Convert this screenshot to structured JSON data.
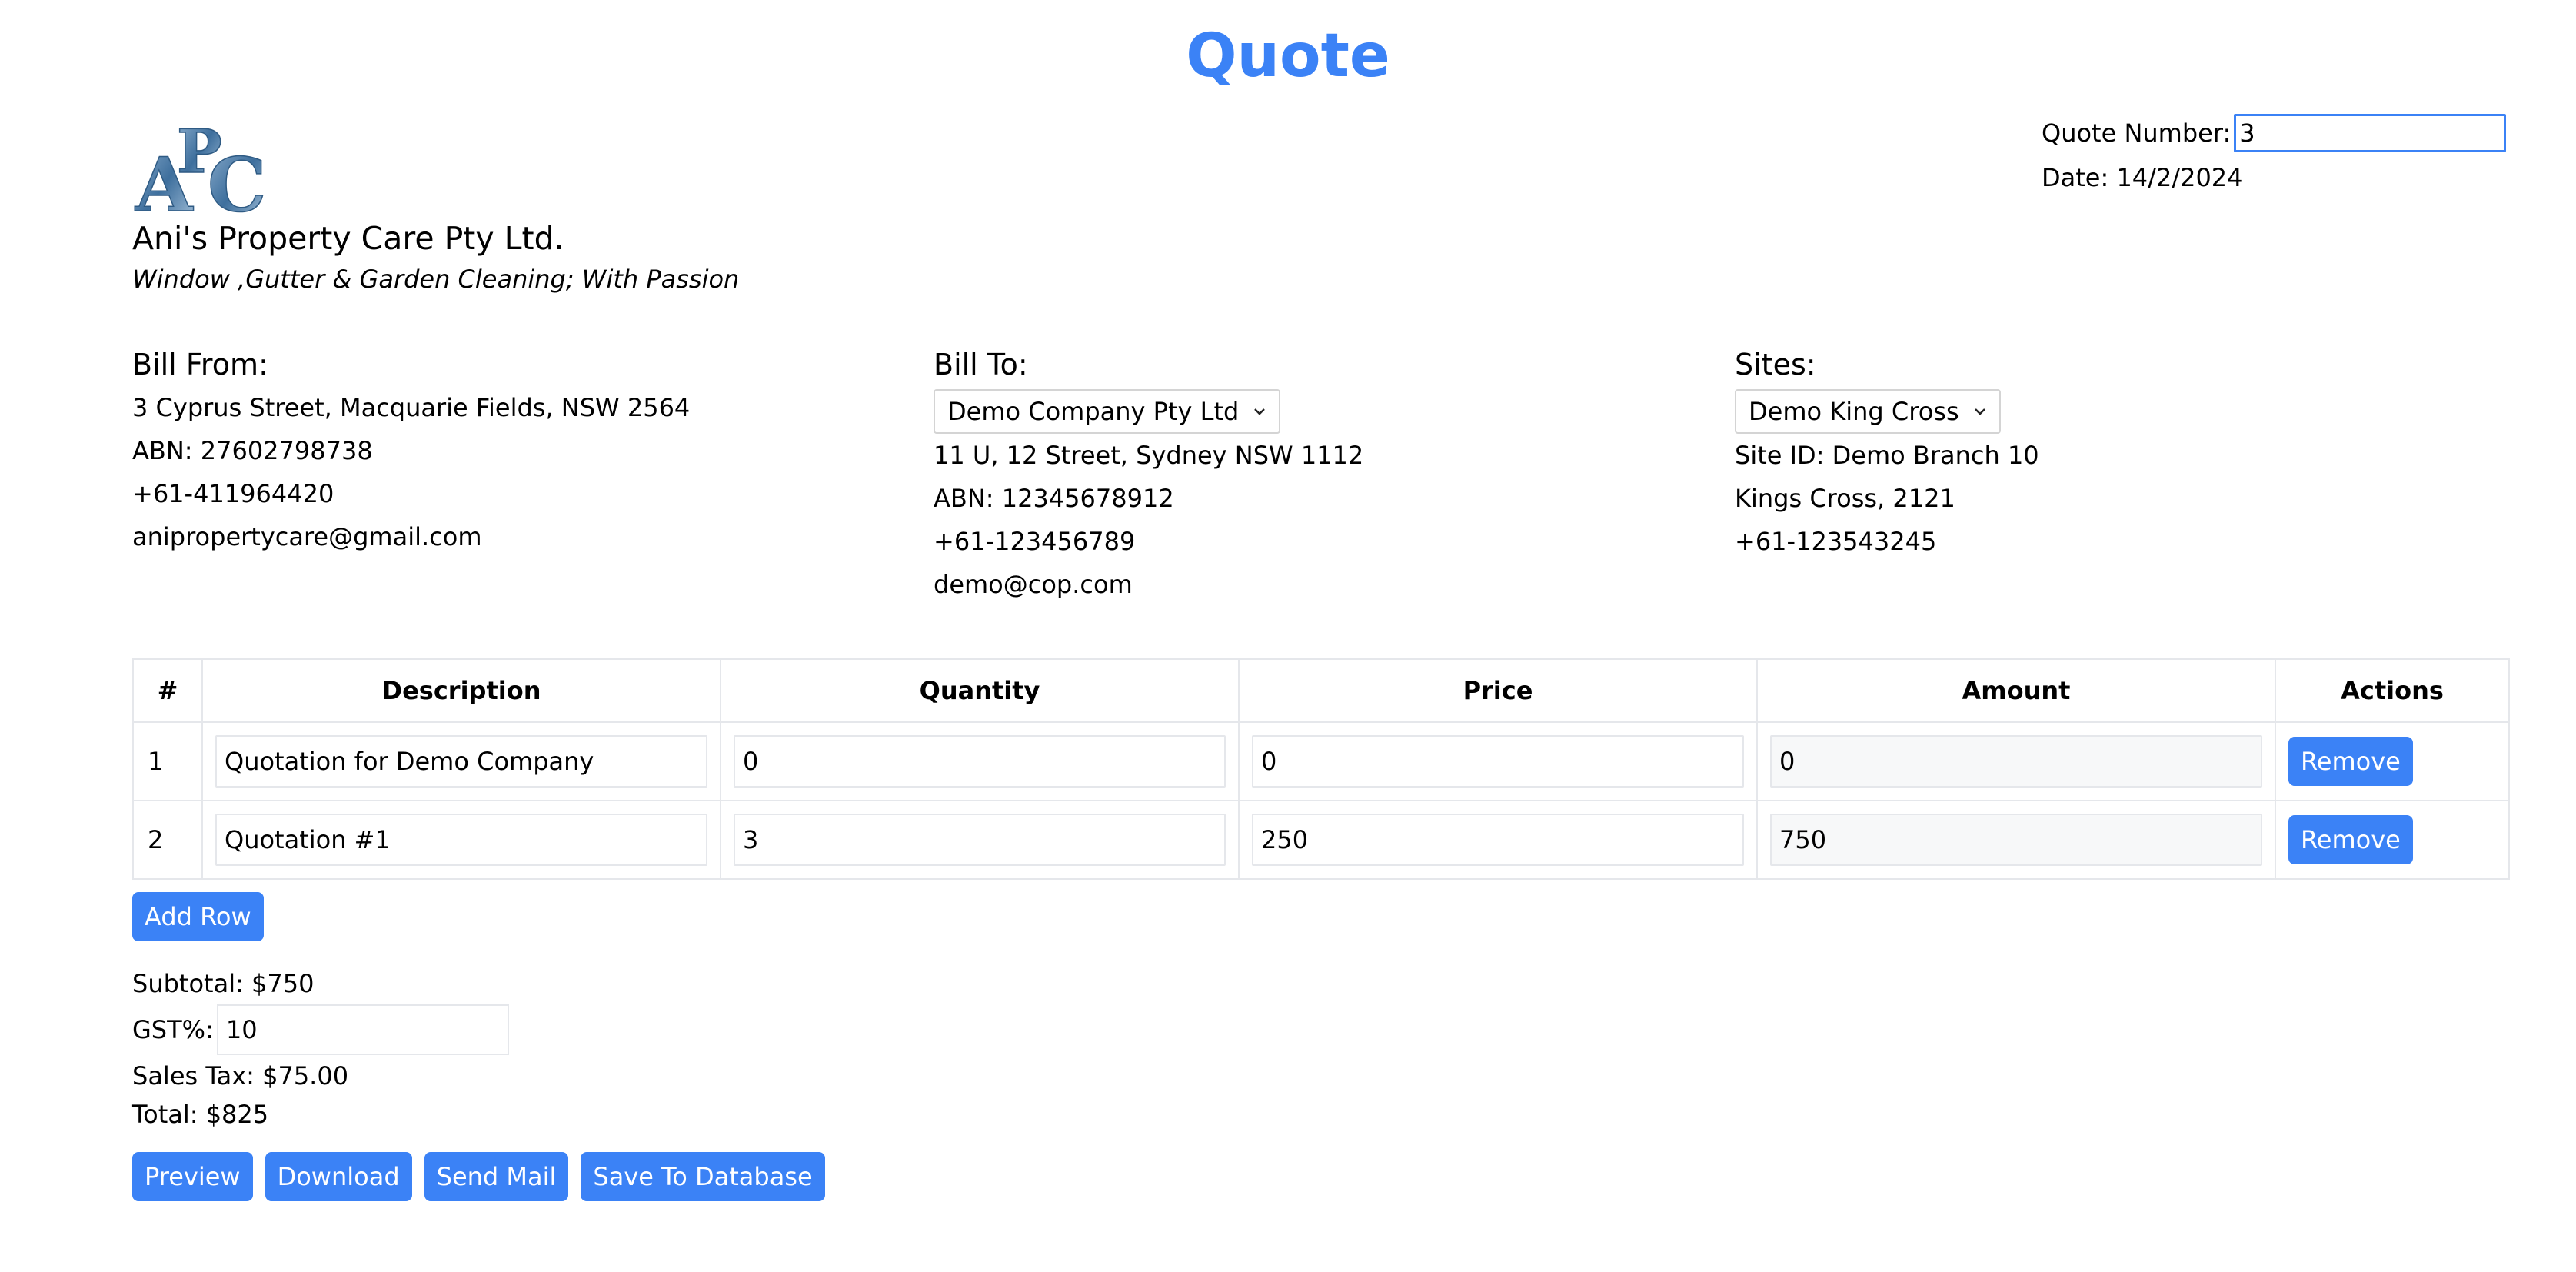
{
  "page": {
    "title": "Quote"
  },
  "company": {
    "logo_text": "APC",
    "name": "Ani's Property Care Pty Ltd.",
    "tagline": "Window ,Gutter & Garden Cleaning; With Passion"
  },
  "quote": {
    "number_label": "Quote Number:",
    "number_value": "3",
    "date_text": "Date: 14/2/2024"
  },
  "bill_from": {
    "heading": "Bill From:",
    "address": "3 Cyprus Street, Macquarie Fields, NSW 2564",
    "abn": "ABN: 27602798738",
    "phone": "+61-411964420",
    "email": "anipropertycare@gmail.com"
  },
  "bill_to": {
    "heading": "Bill To:",
    "selected": "Demo Company Pty Ltd",
    "address": "11 U, 12 Street, Sydney NSW 1112",
    "abn": "ABN: 12345678912",
    "phone": "+61-123456789",
    "email": "demo@cop.com"
  },
  "sites": {
    "heading": "Sites:",
    "selected": "Demo King Cross",
    "site_id": "Site ID: Demo Branch 10",
    "location": "Kings Cross, 2121",
    "phone": "+61-123543245"
  },
  "table": {
    "headers": [
      "#",
      "Description",
      "Quantity",
      "Price",
      "Amount",
      "Actions"
    ],
    "rows": [
      {
        "index": "1",
        "description": "Quotation for Demo Company",
        "quantity": "0",
        "price": "0",
        "amount": "0",
        "action": "Remove"
      },
      {
        "index": "2",
        "description": "Quotation #1",
        "quantity": "3",
        "price": "250",
        "amount": "750",
        "action": "Remove"
      }
    ],
    "add_row_label": "Add Row"
  },
  "totals": {
    "subtotal": "Subtotal: $750",
    "gst_label": "GST%:",
    "gst_value": "10",
    "sales_tax": "Sales Tax: $75.00",
    "total": "Total: $825"
  },
  "buttons": {
    "preview": "Preview",
    "download": "Download",
    "send_mail": "Send Mail",
    "save": "Save To Database"
  },
  "colors": {
    "accent": "#3b82f6",
    "border": "#e5e7eb"
  }
}
